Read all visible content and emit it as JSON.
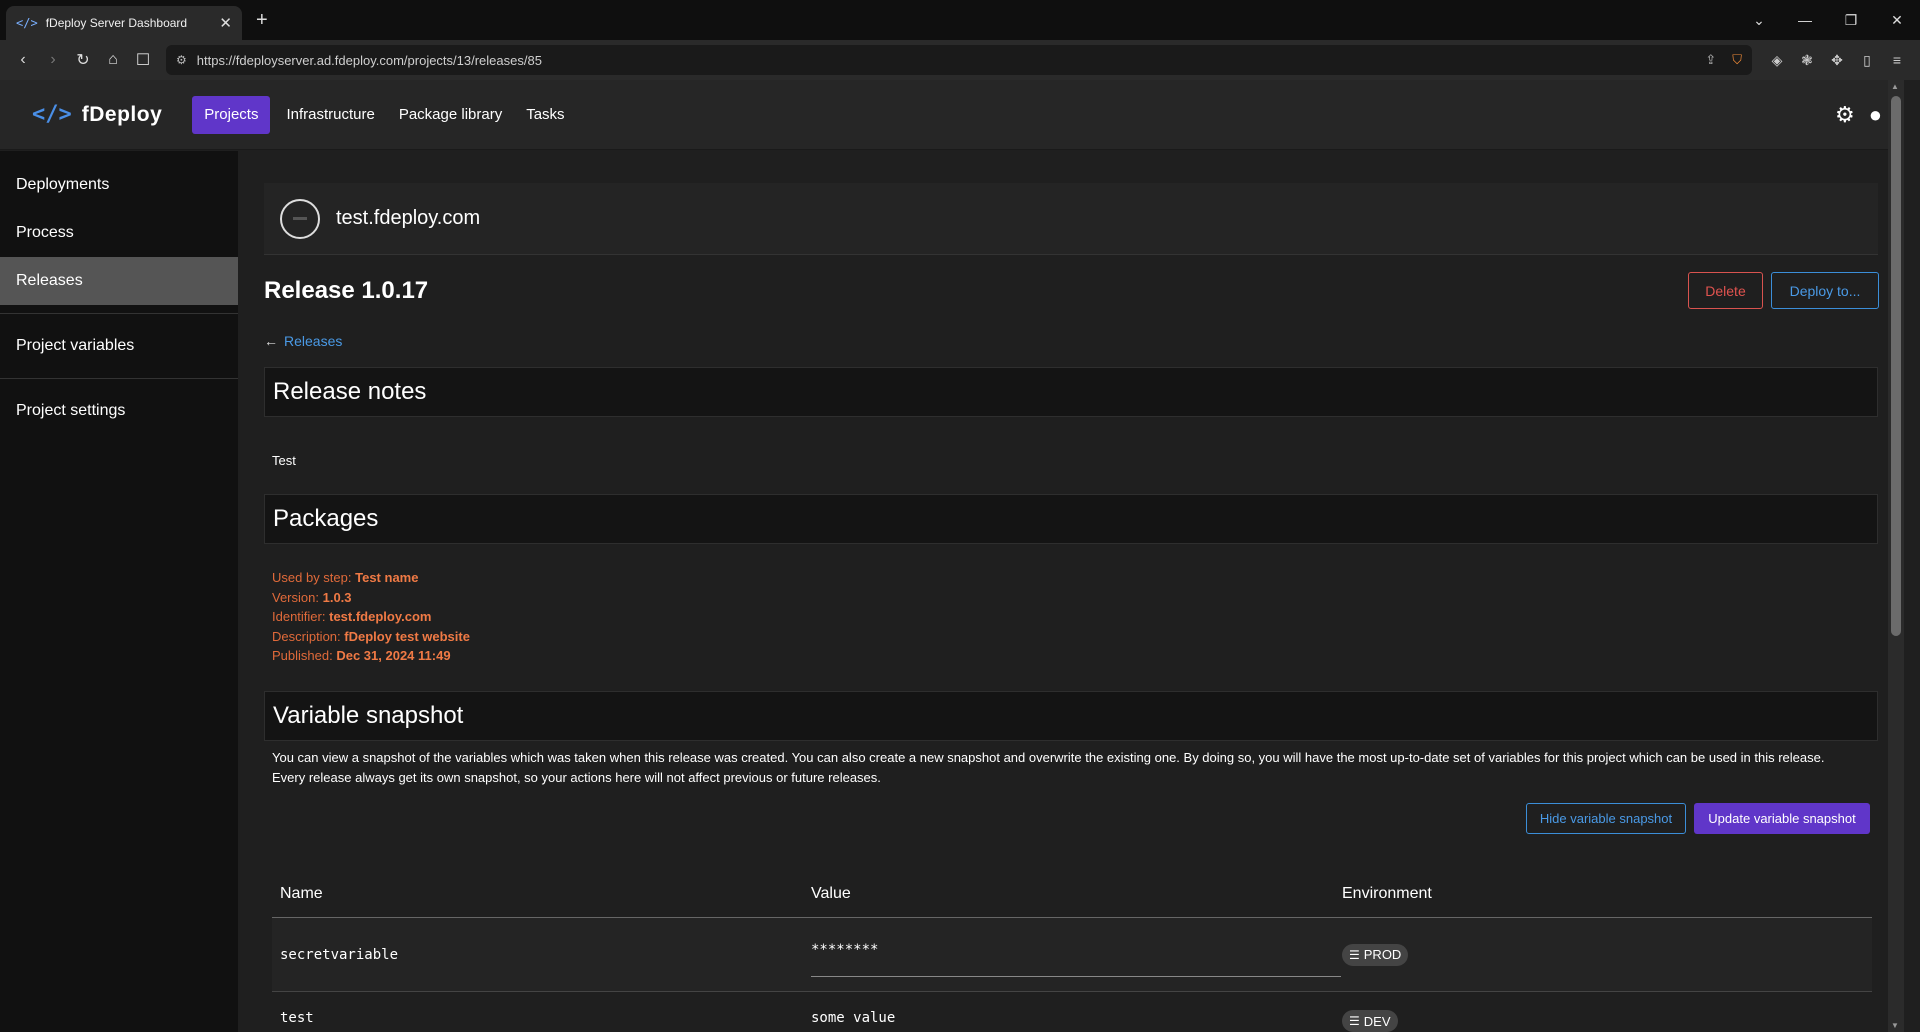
{
  "browser": {
    "tab_title": "fDeploy Server Dashboard",
    "url": "https://fdeployserver.ad.fdeploy.com/projects/13/releases/85"
  },
  "app": {
    "brand_name": "fDeploy",
    "nav": [
      "Projects",
      "Infrastructure",
      "Package library",
      "Tasks"
    ]
  },
  "sidebar": {
    "items": [
      "Deployments",
      "Process",
      "Releases",
      "Project variables",
      "Project settings"
    ]
  },
  "project": {
    "name": "test.fdeploy.com"
  },
  "release": {
    "title": "Release 1.0.17",
    "delete_label": "Delete",
    "deploy_label": "Deploy to...",
    "back_label": "Releases"
  },
  "notes": {
    "heading": "Release notes",
    "text": "Test"
  },
  "packages": {
    "heading": "Packages",
    "used_by_label": "Used by step:",
    "used_by": "Test name",
    "version_label": "Version:",
    "version": "1.0.3",
    "identifier_label": "Identifier:",
    "identifier": "test.fdeploy.com",
    "description_label": "Description:",
    "description": "fDeploy test website",
    "published_label": "Published:",
    "published": "Dec 31, 2024 11:49"
  },
  "snapshot": {
    "heading": "Variable snapshot",
    "description_line1": "You can view a snapshot of the variables which was taken when this release was created. You can also create a new snapshot and overwrite the existing one. By doing so, you will have the most up-to-date set of variables for this project which can be used in this release.",
    "description_line2": "Every release always get its own snapshot, so your actions here will not affect previous or future releases.",
    "hide_label": "Hide variable snapshot",
    "update_label": "Update variable snapshot",
    "columns": [
      "Name",
      "Value",
      "Environment"
    ],
    "rows": [
      {
        "name": "secretvariable",
        "value": "********",
        "env": "PROD"
      },
      {
        "name": "test",
        "value": "some value",
        "env": "DEV"
      }
    ]
  }
}
